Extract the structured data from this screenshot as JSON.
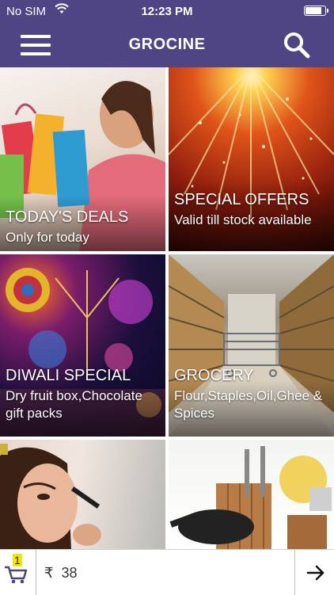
{
  "status_bar": {
    "carrier": "No SIM",
    "time": "12:23 PM"
  },
  "header": {
    "title": "GROCINE",
    "menu_icon": "hamburger-menu-icon",
    "search_icon": "search-icon",
    "bg_color": "#4f4585"
  },
  "tiles": [
    {
      "title": "TODAY'S DEALS",
      "subtitle": "Only for today"
    },
    {
      "title": "SPECIAL OFFERS",
      "subtitle": "Valid till stock available"
    },
    {
      "title": "DIWALI SPECIAL",
      "subtitle": "Dry fruit box,Chocolate gift packs"
    },
    {
      "title": "GROCERY",
      "subtitle": "Flour,Staples,Oil,Ghee & Spices"
    },
    {
      "title": "",
      "subtitle": ""
    },
    {
      "title": "",
      "subtitle": ""
    }
  ],
  "bottom_bar": {
    "cart_count": "1",
    "currency": "₹",
    "amount": "38",
    "cart_icon": "cart-icon",
    "checkout_icon": "arrow-right-icon"
  }
}
